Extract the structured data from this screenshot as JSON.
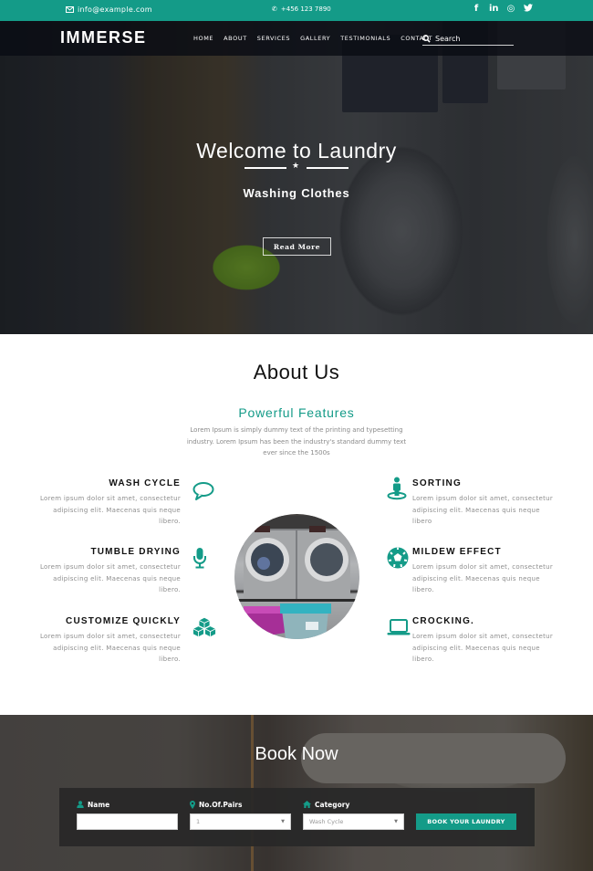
{
  "topbar": {
    "email": "info@example.com",
    "phone": "+456 123 7890",
    "socials": [
      {
        "name": "facebook",
        "glyph": "f"
      },
      {
        "name": "linkedin",
        "glyph": "in"
      },
      {
        "name": "instagram",
        "glyph": "◎"
      },
      {
        "name": "twitter",
        "glyph": "🐦"
      }
    ]
  },
  "navbar": {
    "logo": "IMMERSE",
    "items": [
      "HOME",
      "ABOUT",
      "SERVICES",
      "GALLERY",
      "TESTIMONIALS",
      "CONTACT"
    ],
    "search_placeholder": "Search"
  },
  "hero": {
    "title": "Welcome to Laundry",
    "divider_glyph": "★",
    "subtitle": "Washing Clothes",
    "button_label": "Read More"
  },
  "about": {
    "title": "About Us",
    "features_title": "Powerful Features",
    "description": "Lorem Ipsum is simply dummy text of the printing and typesetting industry. Lorem Ipsum has been the industry's standard dummy text ever since the 1500s",
    "features_left": [
      {
        "title": "WASH CYCLE",
        "icon": "speech-bubble-icon",
        "text": "Lorem ipsum dolor sit amet, consectetur adipiscing elit. Maecenas quis neque libero."
      },
      {
        "title": "TUMBLE DRYING",
        "icon": "microphone-icon",
        "text": "Lorem ipsum dolor sit amet, consectetur adipiscing elit. Maecenas quis neque libero."
      },
      {
        "title": "CUSTOMIZE QUICKLY",
        "icon": "cubes-icon",
        "text": "Lorem ipsum dolor sit amet, consectetur adipiscing elit. Maecenas quis neque libero."
      }
    ],
    "features_right": [
      {
        "title": "SORTING",
        "icon": "street-view-icon",
        "text": "Lorem ipsum dolor sit amet, consectetur adipiscing elit. Maecenas quis neque libero"
      },
      {
        "title": "MILDEW EFFECT",
        "icon": "soccer-ball-icon",
        "text": "Lorem ipsum dolor sit amet, consectetur adipiscing elit. Maecenas quis neque libero."
      },
      {
        "title": "CROCKING.",
        "icon": "laptop-icon",
        "text": "Lorem ipsum dolor sit amet, consectetur adipiscing elit. Maecenas quis neque libero."
      }
    ]
  },
  "booking": {
    "title": "Book Now",
    "fields": {
      "name_label": "Name",
      "name_value": "",
      "pairs_label": "No.Of.Pairs",
      "pairs_value": "1",
      "category_label": "Category",
      "category_value": "Wash Cycle"
    },
    "button_label": "BOOK YOUR LAUNDRY"
  },
  "colors": {
    "accent": "#149b88",
    "navbar": "#0a0c14",
    "form_bg": "#282828"
  }
}
